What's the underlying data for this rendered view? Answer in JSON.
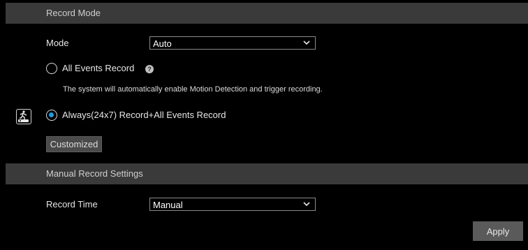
{
  "record_mode": {
    "header": "Record Mode",
    "mode_label": "Mode",
    "mode_value": "Auto",
    "option_all_events": "All Events Record",
    "help_glyph": "?",
    "description": "The system will automatically enable Motion Detection and trigger recording.",
    "option_always": "Always(24x7) Record+All Events Record",
    "customized_button": "Customized",
    "icon": "motion-record-on-icon"
  },
  "manual_record": {
    "header": "Manual Record Settings",
    "record_time_label": "Record Time",
    "record_time_value": "Manual"
  },
  "apply_button": "Apply",
  "colors": {
    "background": "#000000",
    "header_bg": "#3a3a3a",
    "accent": "#1e9be0"
  }
}
